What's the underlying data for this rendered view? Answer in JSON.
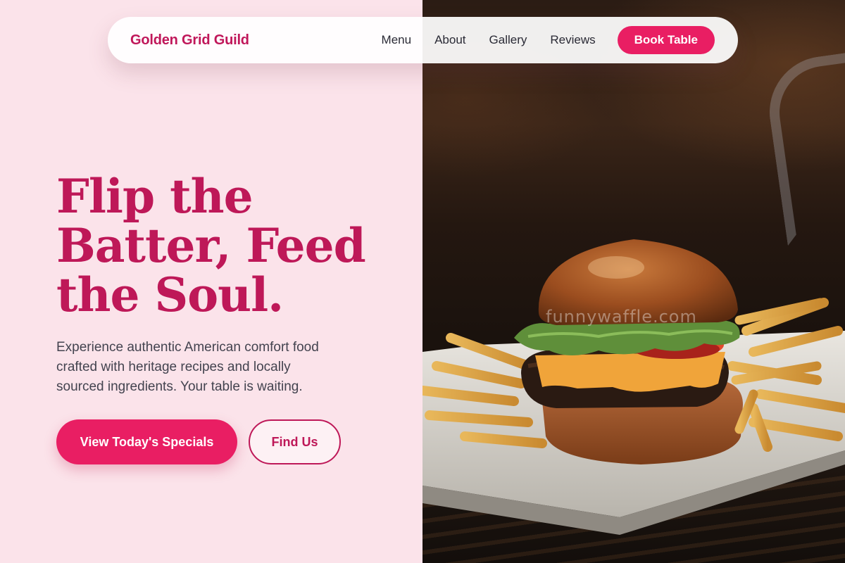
{
  "brand": {
    "name": "Golden Grid Guild",
    "color": "#c0175a"
  },
  "nav": {
    "links": [
      "Menu",
      "About",
      "Gallery",
      "Reviews"
    ],
    "cta": "Book Table",
    "cta_color": "#e91e63"
  },
  "hero": {
    "title_lines": [
      "Flip the",
      "Batter, Feed",
      "the Soul."
    ],
    "description_lines": [
      "Experience authentic American comfort food",
      "crafted with heritage recipes and locally",
      "sourced ingredients. Your table is waiting."
    ],
    "primary_button": "View Today's Specials",
    "secondary_button": "Find Us"
  },
  "image": {
    "subject": "burger-with-fries-photo",
    "watermark": "funnywaffle.com"
  },
  "colors": {
    "background": "#fbe3ea",
    "accent": "#e91e63",
    "heading": "#be1858",
    "body_text": "#43434f"
  }
}
